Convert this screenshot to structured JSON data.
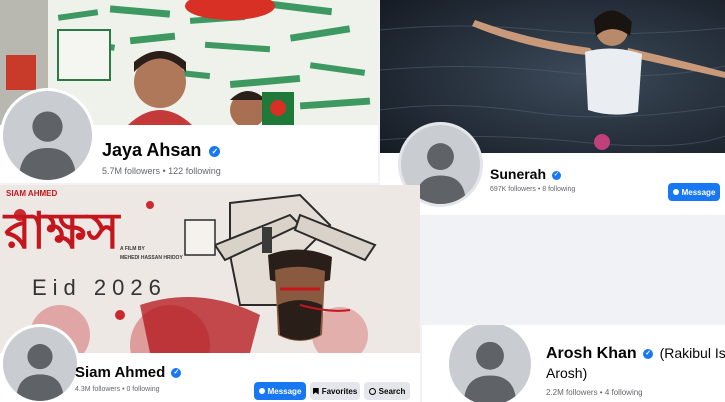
{
  "cards": {
    "jaya": {
      "name": "Jaya Ahsan",
      "stats": "5.7M followers • 122 following"
    },
    "sunerah": {
      "name": "Sunerah",
      "stats": "697K followers • 8 following",
      "message_label": "Message"
    },
    "siam": {
      "name": "Siam Ahmed",
      "stats": "4.3M followers • 0 following",
      "message_label": "Message",
      "favorites_label": "Favorites",
      "search_label": "Search",
      "poster": {
        "top_credit": "SIAM AHMED",
        "title": "রাক্ষস",
        "film_credit": "A FILM BY",
        "director": "MEHEDI HASSAN HRIDOY",
        "release": "Eid 2026"
      }
    },
    "arosh": {
      "name": "Arosh Khan",
      "name_suffix": "(Rakibul Is",
      "name_line2": "Arosh)",
      "stats": "2.2M followers • 4 following"
    }
  },
  "icons": {
    "verified": "check-badge-icon",
    "messenger": "messenger-icon",
    "favorites": "bookmark-icon",
    "search": "search-icon"
  },
  "colors": {
    "accent": "#1877f2",
    "poster_red": "#c4161c"
  }
}
